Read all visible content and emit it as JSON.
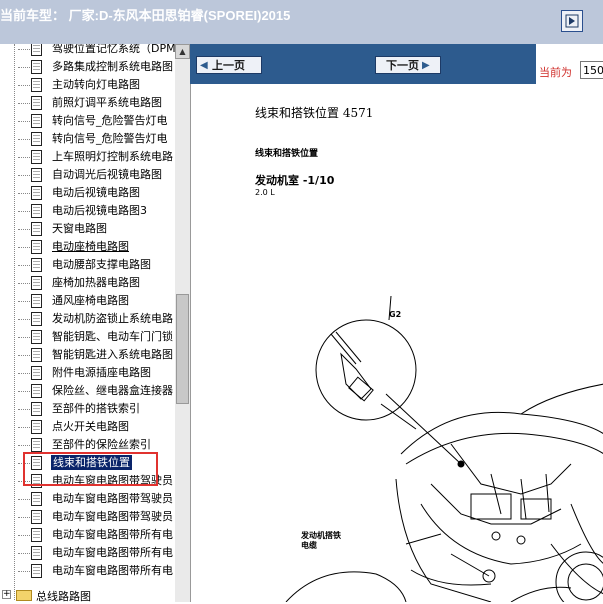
{
  "header": {
    "title": "当前车型：  厂家:D-东风本田思铂睿(SPOREI)2015"
  },
  "tree": {
    "items": [
      {
        "label": "驾驶位置记忆系统（DPM",
        "underline": false
      },
      {
        "label": "多路集成控制系统电路图",
        "underline": false
      },
      {
        "label": "主动转向灯电路图",
        "underline": false
      },
      {
        "label": "前照灯调平系统电路图",
        "underline": false
      },
      {
        "label": "转向信号_危险警告灯电",
        "underline": false
      },
      {
        "label": "转向信号_危险警告灯电",
        "underline": false
      },
      {
        "label": "上车照明灯控制系统电路",
        "underline": false
      },
      {
        "label": "自动调光后视镜电路图",
        "underline": false
      },
      {
        "label": "电动后视镜电路图",
        "underline": false
      },
      {
        "label": "电动后视镜电路图3",
        "underline": false
      },
      {
        "label": "天窗电路图",
        "underline": false
      },
      {
        "label": "电动座椅电路图",
        "underline": true
      },
      {
        "label": "电动腰部支撑电路图",
        "underline": false
      },
      {
        "label": "座椅加热器电路图",
        "underline": false
      },
      {
        "label": "通风座椅电路图",
        "underline": false
      },
      {
        "label": "发动机防盗锁止系统电路",
        "underline": false
      },
      {
        "label": "智能钥匙、电动车门门锁",
        "underline": false
      },
      {
        "label": "智能钥匙进入系统电路图",
        "underline": false
      },
      {
        "label": "附件电源插座电路图",
        "underline": false
      },
      {
        "label": "保险丝、继电器盒连接器",
        "underline": false
      },
      {
        "label": "至部件的搭铁索引",
        "underline": false
      },
      {
        "label": "点火开关电路图",
        "underline": false
      },
      {
        "label": "至部件的保险丝索引",
        "underline": false
      },
      {
        "label": "线束和搭铁位置",
        "underline": false,
        "selected": true
      },
      {
        "label": "电动车窗电路图带驾驶员",
        "underline": false
      },
      {
        "label": "电动车窗电路图带驾驶员",
        "underline": false
      },
      {
        "label": "电动车窗电路图带驾驶员",
        "underline": false
      },
      {
        "label": "电动车窗电路图带所有电",
        "underline": false
      },
      {
        "label": "电动车窗电路图带所有电",
        "underline": false
      },
      {
        "label": "电动车窗电路图带所有电",
        "underline": false
      }
    ],
    "folder_label": "总线路路图"
  },
  "nav": {
    "prev_label": "上一页",
    "next_label": "下一页",
    "page_label": "当前为",
    "page_value": "150"
  },
  "document": {
    "title": "线束和搭铁位置  4571",
    "section": "线束和搭铁位置",
    "subtitle": "发动机室 -1/10",
    "engine": "2.0 L",
    "label_g2": "G2",
    "label_harness": "发动机搭铁",
    "label_harness2": "电缆"
  },
  "colors": {
    "topbar": "#bcc7da",
    "navbar": "#2d5b8e",
    "highlight": "#e0322f",
    "selection": "#0a246a"
  }
}
